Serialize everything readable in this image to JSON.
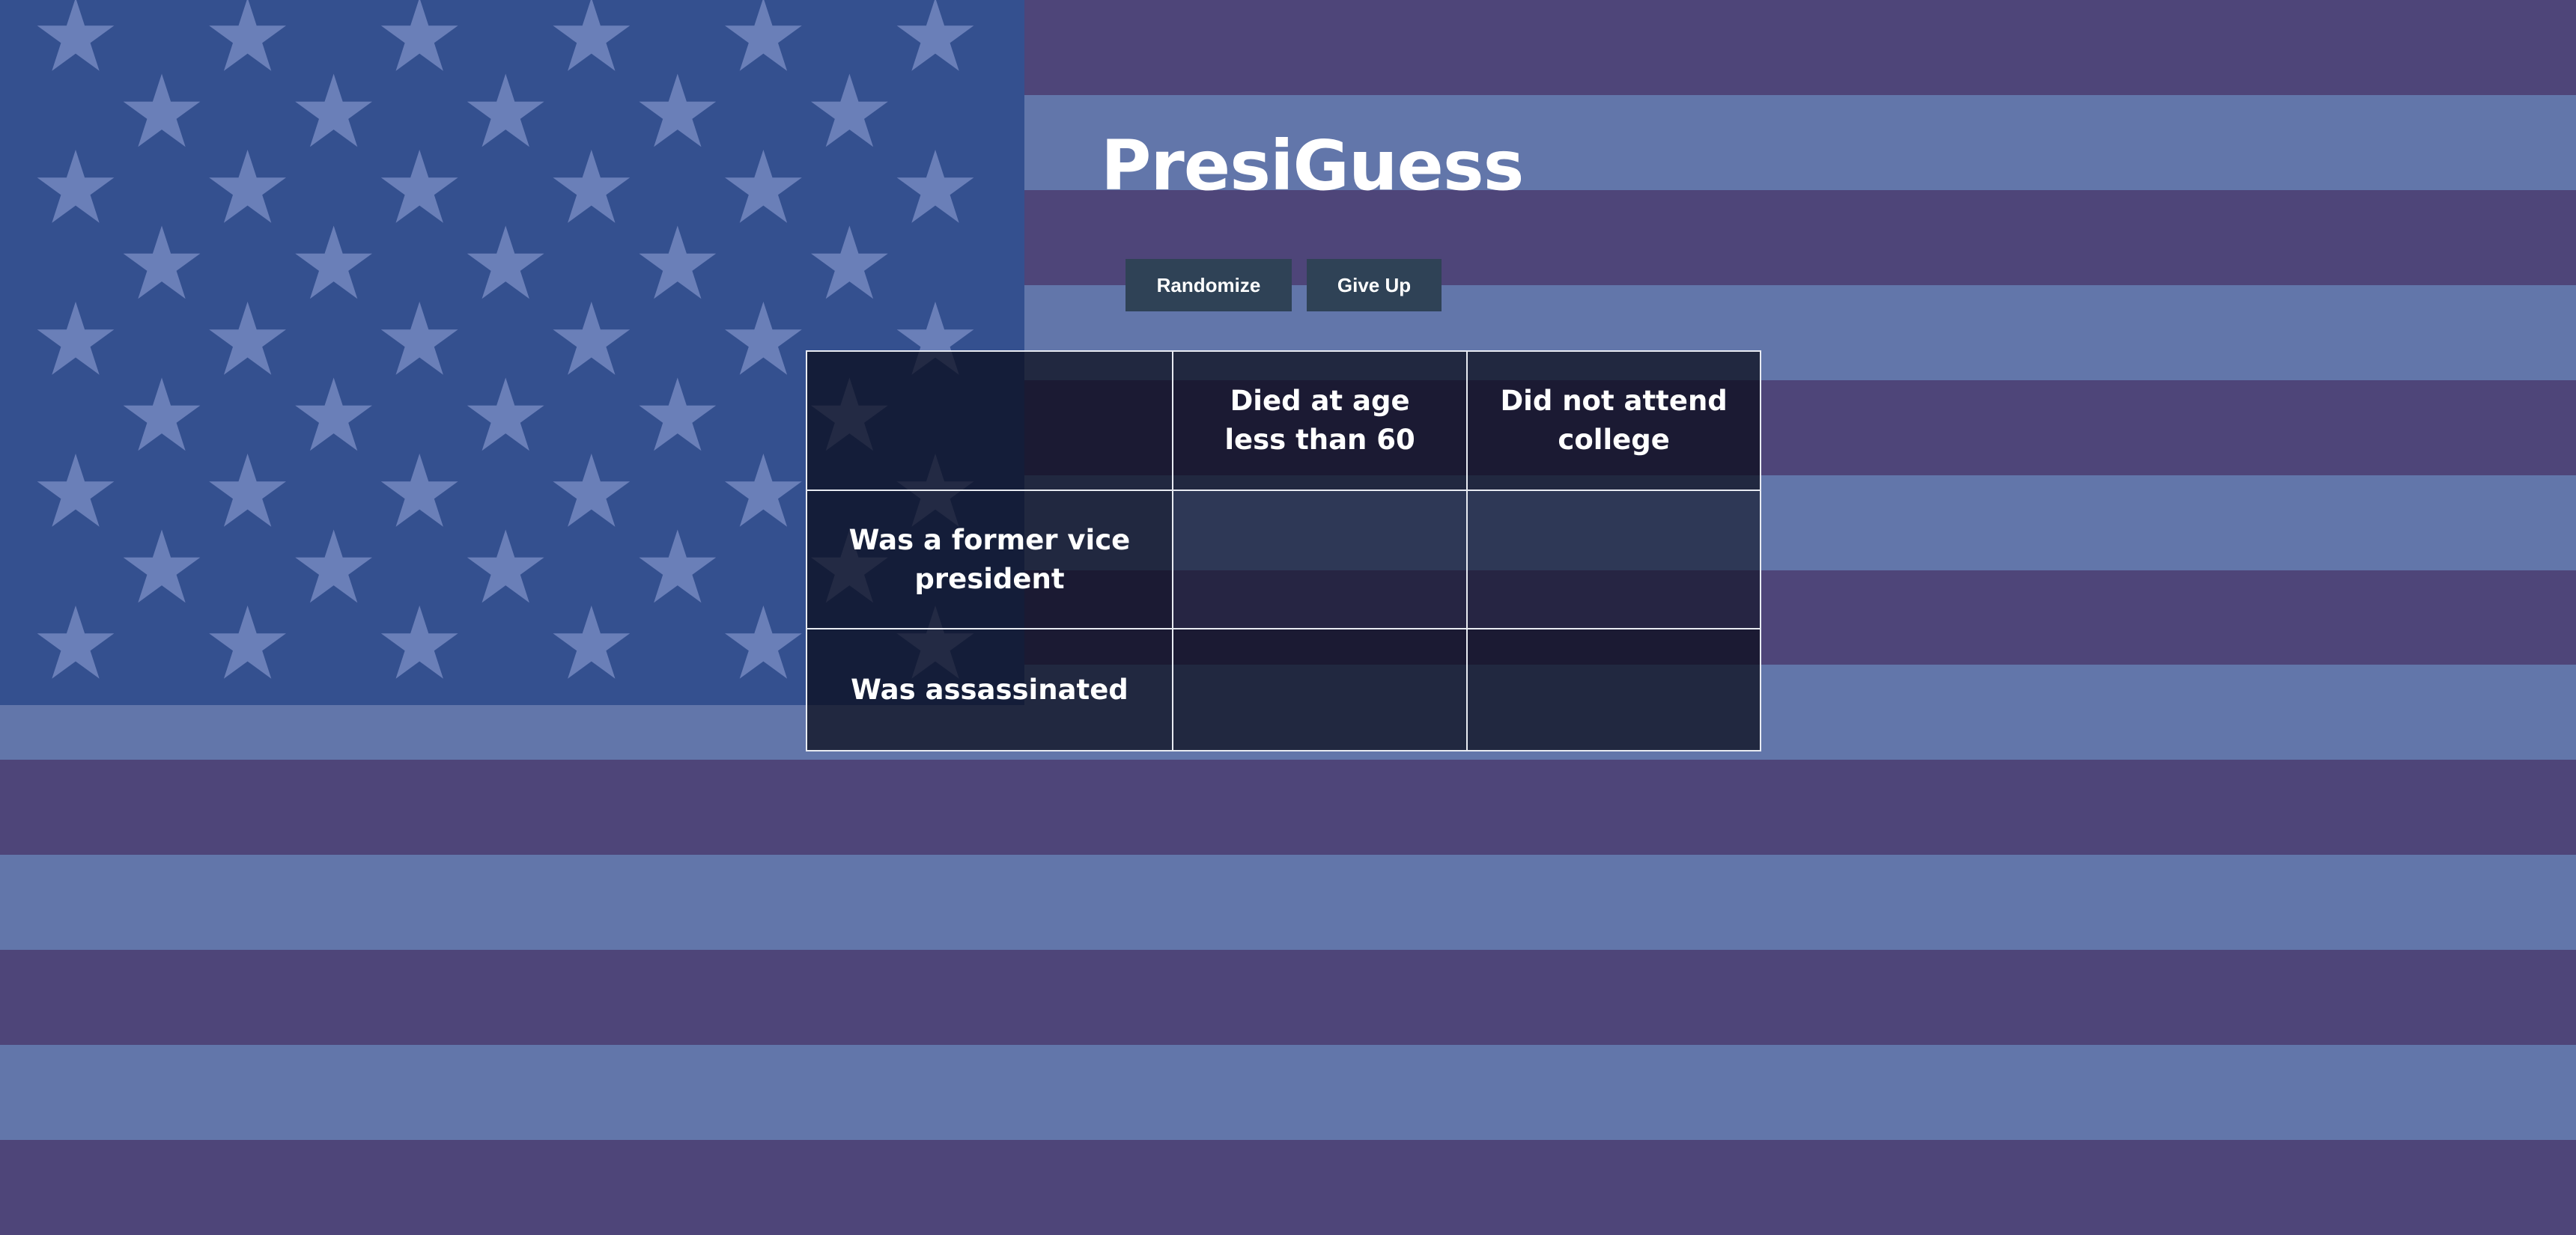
{
  "app": {
    "title": "PresiGuess"
  },
  "toolbar": {
    "randomize_label": "Randomize",
    "give_up_label": "Give Up"
  },
  "grid": {
    "columns": [
      "",
      "Died at age less than 60",
      "Did not attend college"
    ],
    "rows": [
      {
        "label": "Was a former vice president",
        "cells": [
          "",
          ""
        ]
      },
      {
        "label": "Was assassinated",
        "cells": [
          "",
          ""
        ]
      }
    ]
  },
  "colors": {
    "stripe_dark": "#4e4579",
    "stripe_light": "#6276aa",
    "canton": "#34508f",
    "star": "#6a7fb8",
    "button_bg": "#2f4256",
    "cell_bg": "#0c0e1c"
  }
}
